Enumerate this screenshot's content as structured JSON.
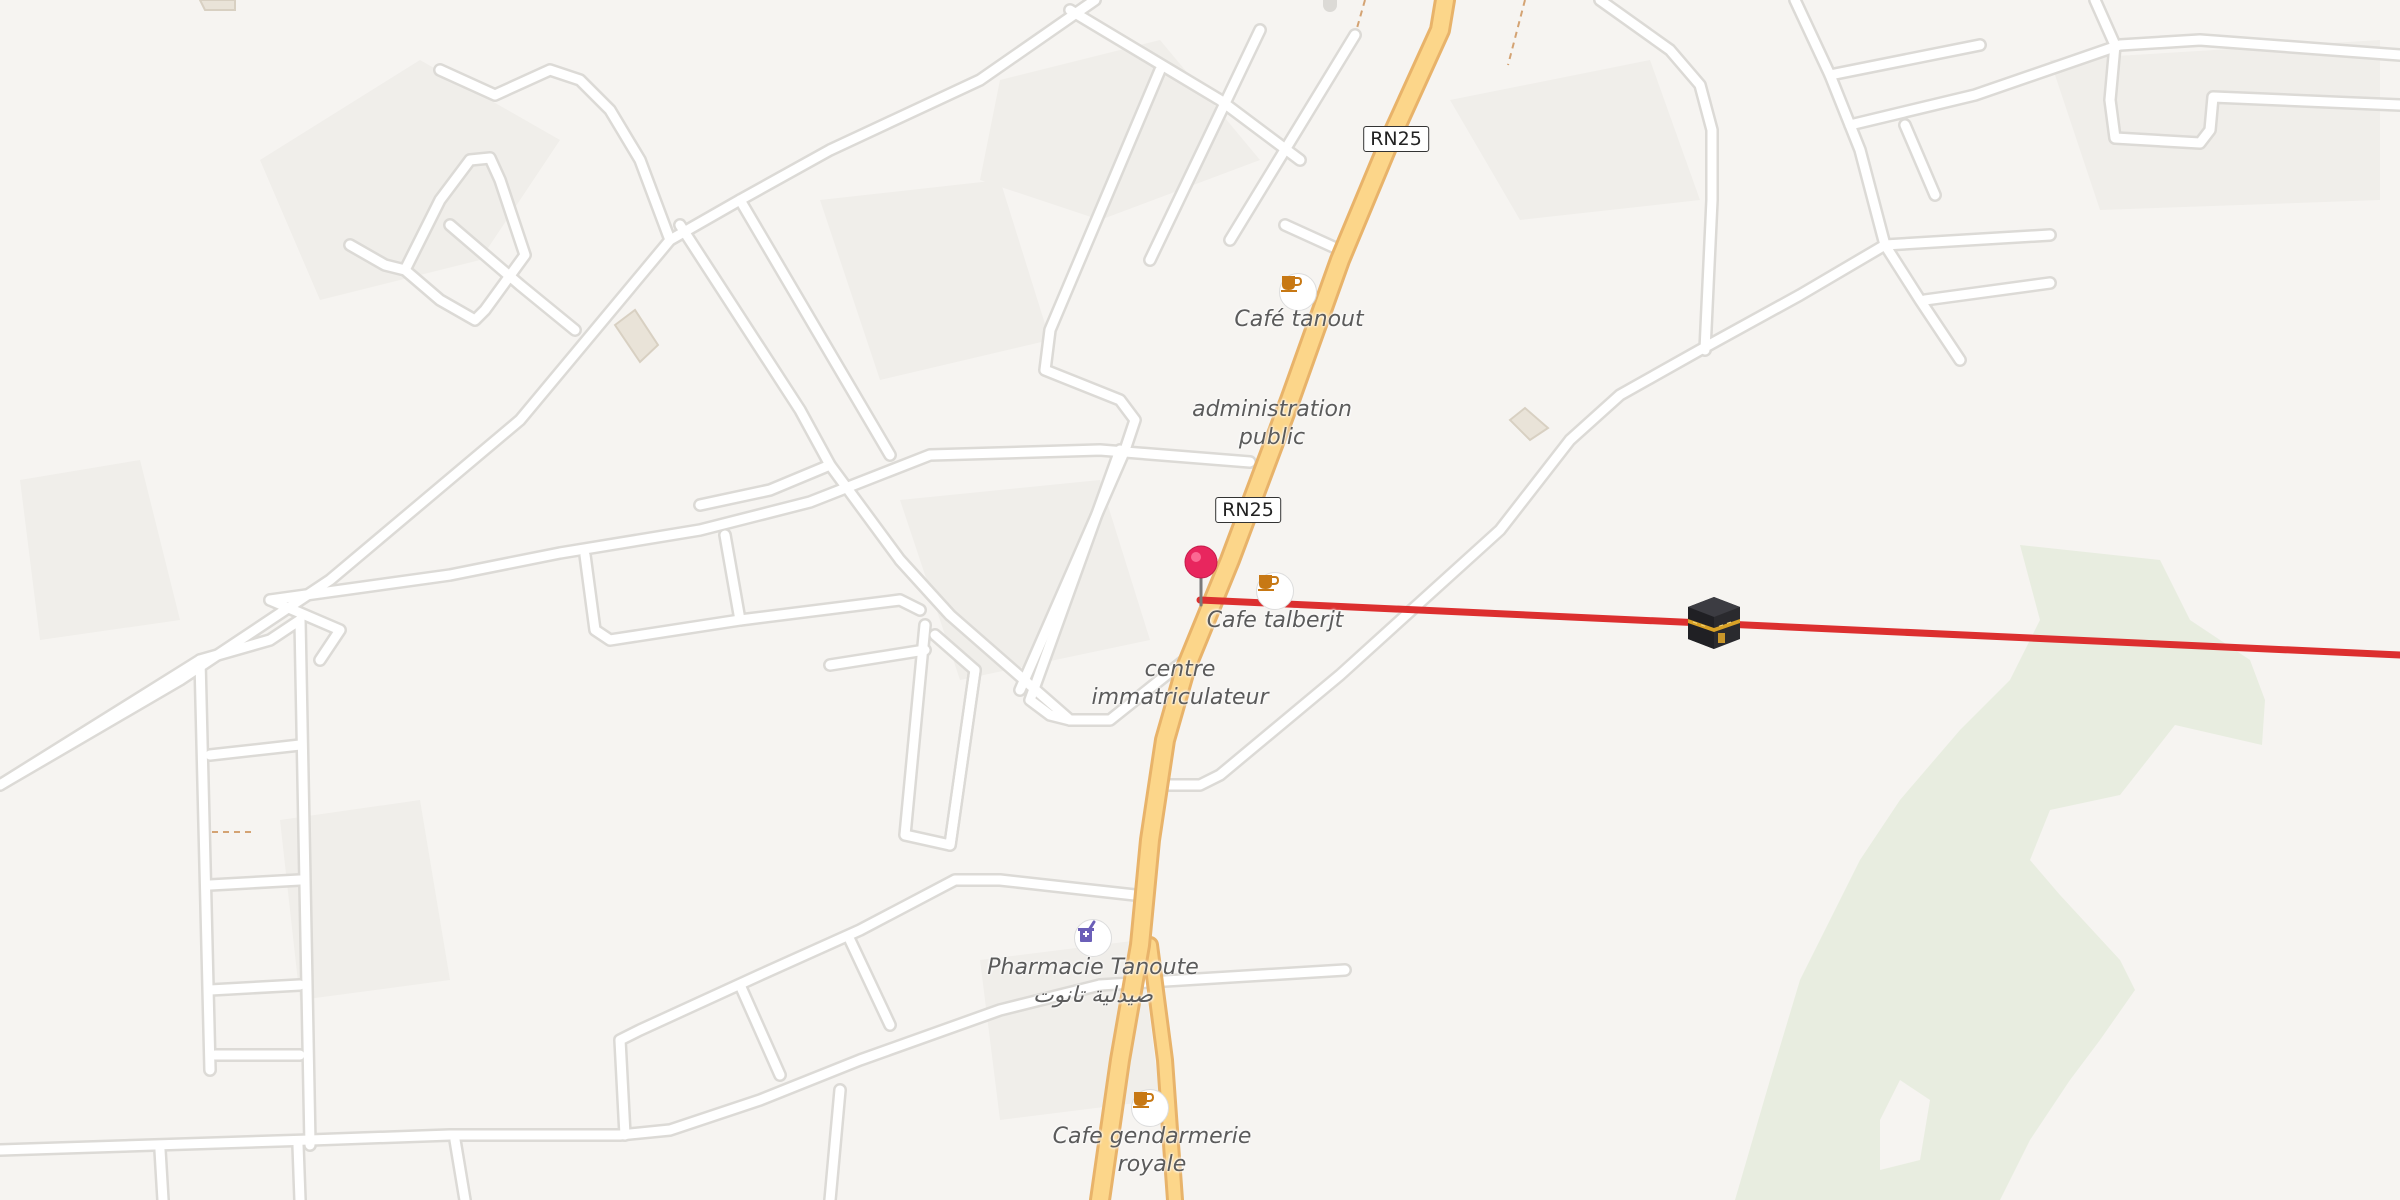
{
  "map": {
    "road_shields": [
      {
        "ref_label": "RN25"
      },
      {
        "ref_label": "RN25"
      }
    ],
    "pois": [
      {
        "name": "Café tanout",
        "type": "cafe",
        "icon": "cafe-icon"
      },
      {
        "name": "administration",
        "name_line2": "public",
        "type": "government",
        "icon": ""
      },
      {
        "name": "Cafe talberjt",
        "type": "cafe",
        "icon": "cafe-icon"
      },
      {
        "name": "centre",
        "name_line2": "immatriculateur",
        "type": "office",
        "icon": ""
      },
      {
        "name": "Pharmacie Tanoute",
        "name_line2": "صيدلية تانوت",
        "type": "pharmacy",
        "icon": "pharmacy-icon"
      },
      {
        "name": "Cafe gendarmerie",
        "name_line2": "royale",
        "type": "cafe",
        "icon": "cafe-icon"
      }
    ],
    "markers": {
      "location_pin": {
        "icon": "map-pin-icon",
        "color": "#e8265e"
      },
      "qibla_target": {
        "icon": "kaaba-icon"
      },
      "qibla_line": {
        "color": "#dc2f2f"
      }
    },
    "colors": {
      "background": "#f6f4f1",
      "primary_road_fill": "#fcd68a",
      "primary_road_casing": "#e8b36a",
      "minor_road": "#ffffff",
      "minor_road_casing": "#dcdad6",
      "vegetation": "#e8ede0",
      "cafe_icon": "#c77814",
      "pharmacy_icon": "#6b5fb8"
    }
  }
}
